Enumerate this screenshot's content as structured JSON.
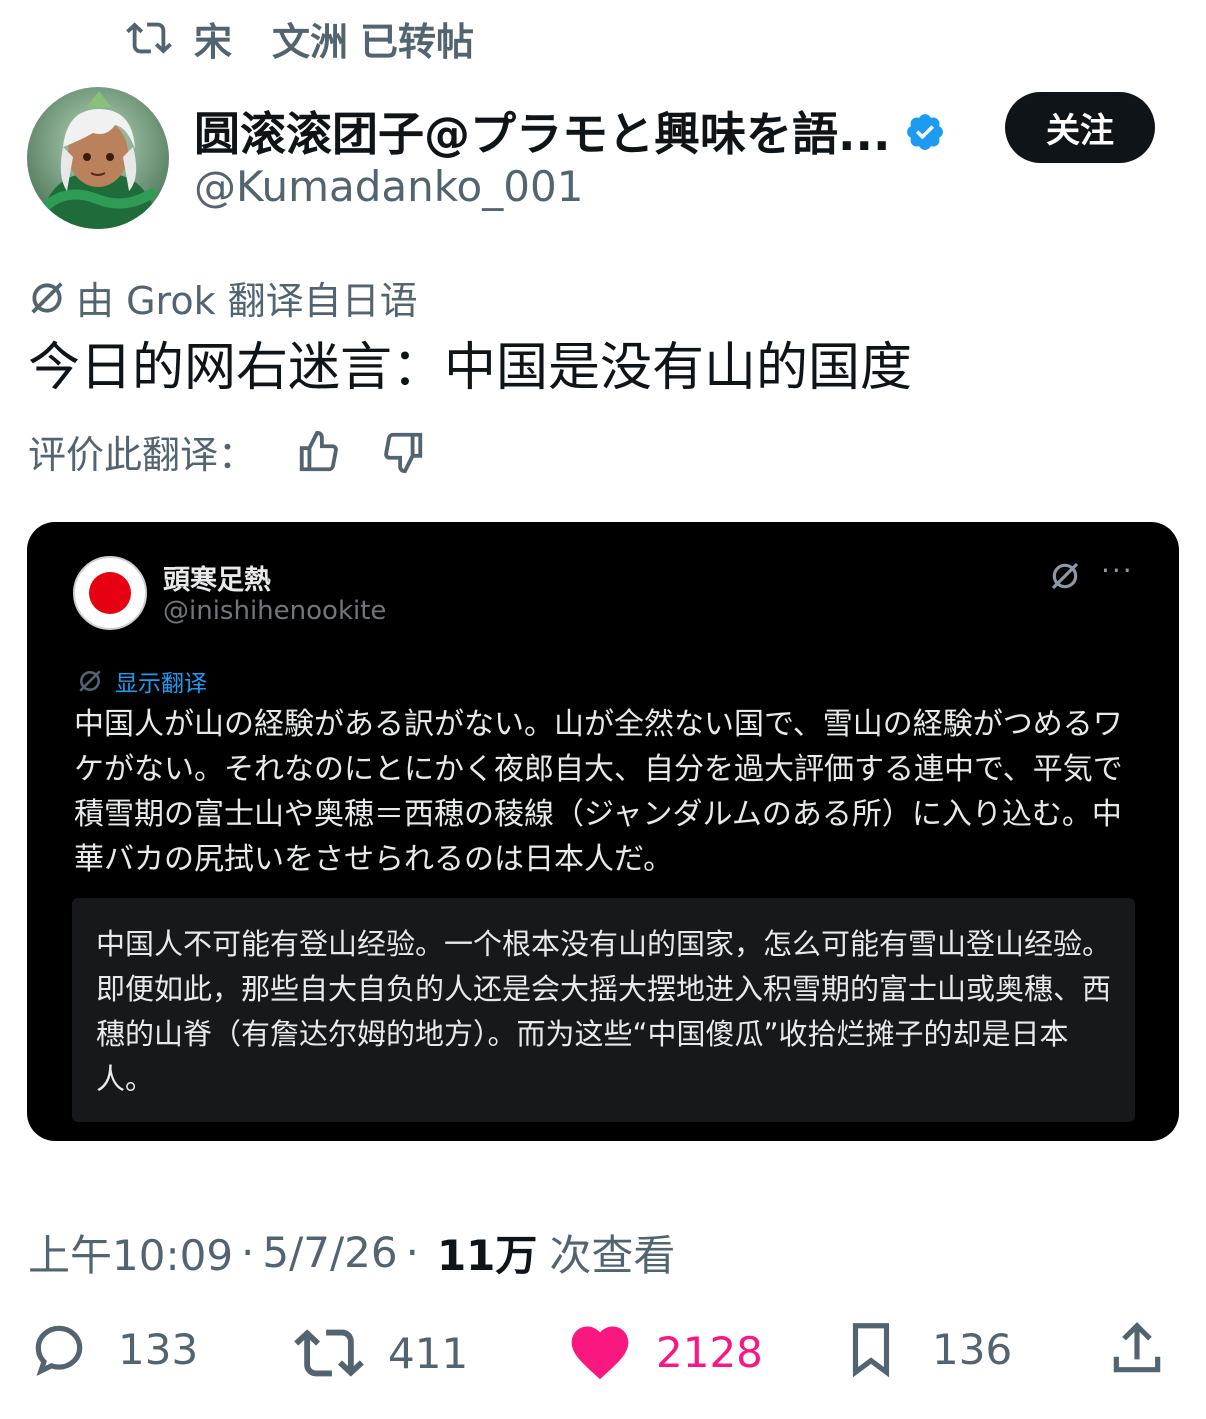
{
  "repost": {
    "icon": "repost-icon",
    "name_part1": "宋",
    "name_part2": "文洲",
    "suffix": "已转帖"
  },
  "author": {
    "display_name": "圆滚滚团子@プラモと興味を語...",
    "handle": "@Kumadanko_001",
    "verified": true,
    "avatar": "anime-character-avatar"
  },
  "follow_button": "关注",
  "translation_note": "由 Grok 翻译自日语",
  "post_text": "今日的网右迷言：中国是没有山的国度",
  "rate_translation": "评价此翻译：",
  "embedded": {
    "display_name": "頭寒足熱",
    "handle": "@inishihenookite",
    "show_translation": "显示翻译",
    "original_text": "中国人が山の経験がある訳がない。山が全然ない国で、雪山の経験がつめるワケがない。それなのにとにかく夜郎自大、自分を過大評価する連中で、平気で積雪期の富士山や奥穂＝西穂の稜線（ジャンダルムのある所）に入り込む。中華バカの尻拭いをさせられるのは日本人だ。",
    "translated_text": "中国人不可能有登山经验。一个根本没有山的国家，怎么可能有雪山登山经验。即便如此，那些自大自负的人还是会大摇大摆地进入积雪期的富士山或奥穗、西穗的山脊（有詹达尔姆的地方）。而为这些“中国傻瓜”收拾烂摊子的却是日本人。",
    "more": "···"
  },
  "meta": {
    "time": "上午10:09",
    "date": "5/7/26",
    "views_count": "11万",
    "views_label": "次查看"
  },
  "actions": {
    "replies": "133",
    "reposts": "411",
    "likes": "2128",
    "bookmarks": "136"
  },
  "colors": {
    "like": "#f91880",
    "verified": "#1d9bf0",
    "muted": "#536471"
  }
}
